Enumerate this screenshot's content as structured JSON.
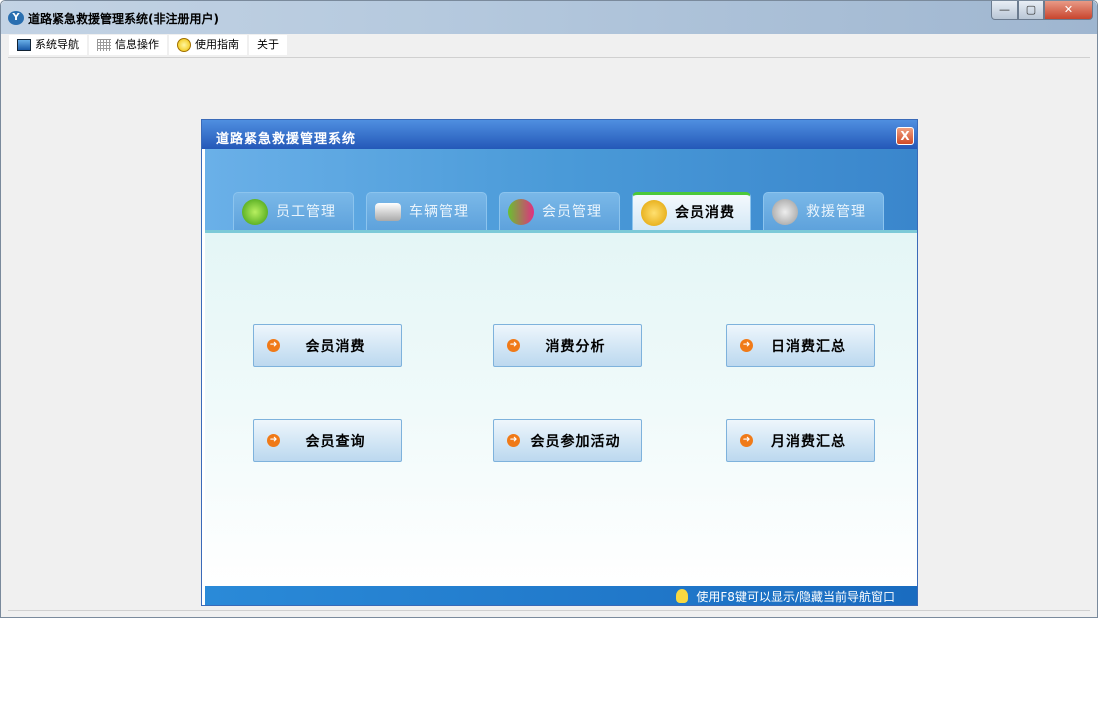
{
  "window": {
    "title": "道路紧急救援管理系统(非注册用户)",
    "controls": {
      "minimize": "—",
      "maximize": "▢",
      "close": "✕"
    }
  },
  "menu": [
    {
      "label": "系统导航"
    },
    {
      "label": "信息操作"
    },
    {
      "label": "使用指南"
    },
    {
      "label": "关于"
    }
  ],
  "dialog": {
    "title": "道路紧急救援管理系统",
    "close": "X",
    "tabs": [
      {
        "label": "员工管理"
      },
      {
        "label": "车辆管理"
      },
      {
        "label": "会员管理"
      },
      {
        "label": "会员消费",
        "active": true
      },
      {
        "label": "救援管理"
      }
    ],
    "buttons": [
      {
        "label": "会员消费"
      },
      {
        "label": "消费分析"
      },
      {
        "label": "日消费汇总"
      },
      {
        "label": "会员查询"
      },
      {
        "label": "会员参加活动"
      },
      {
        "label": "月消费汇总"
      }
    ],
    "status": "使用F8键可以显示/隐藏当前导航窗口"
  },
  "colors": {
    "active_tab_accent": "#4cc83a",
    "button_arrow": "#f07a18"
  }
}
